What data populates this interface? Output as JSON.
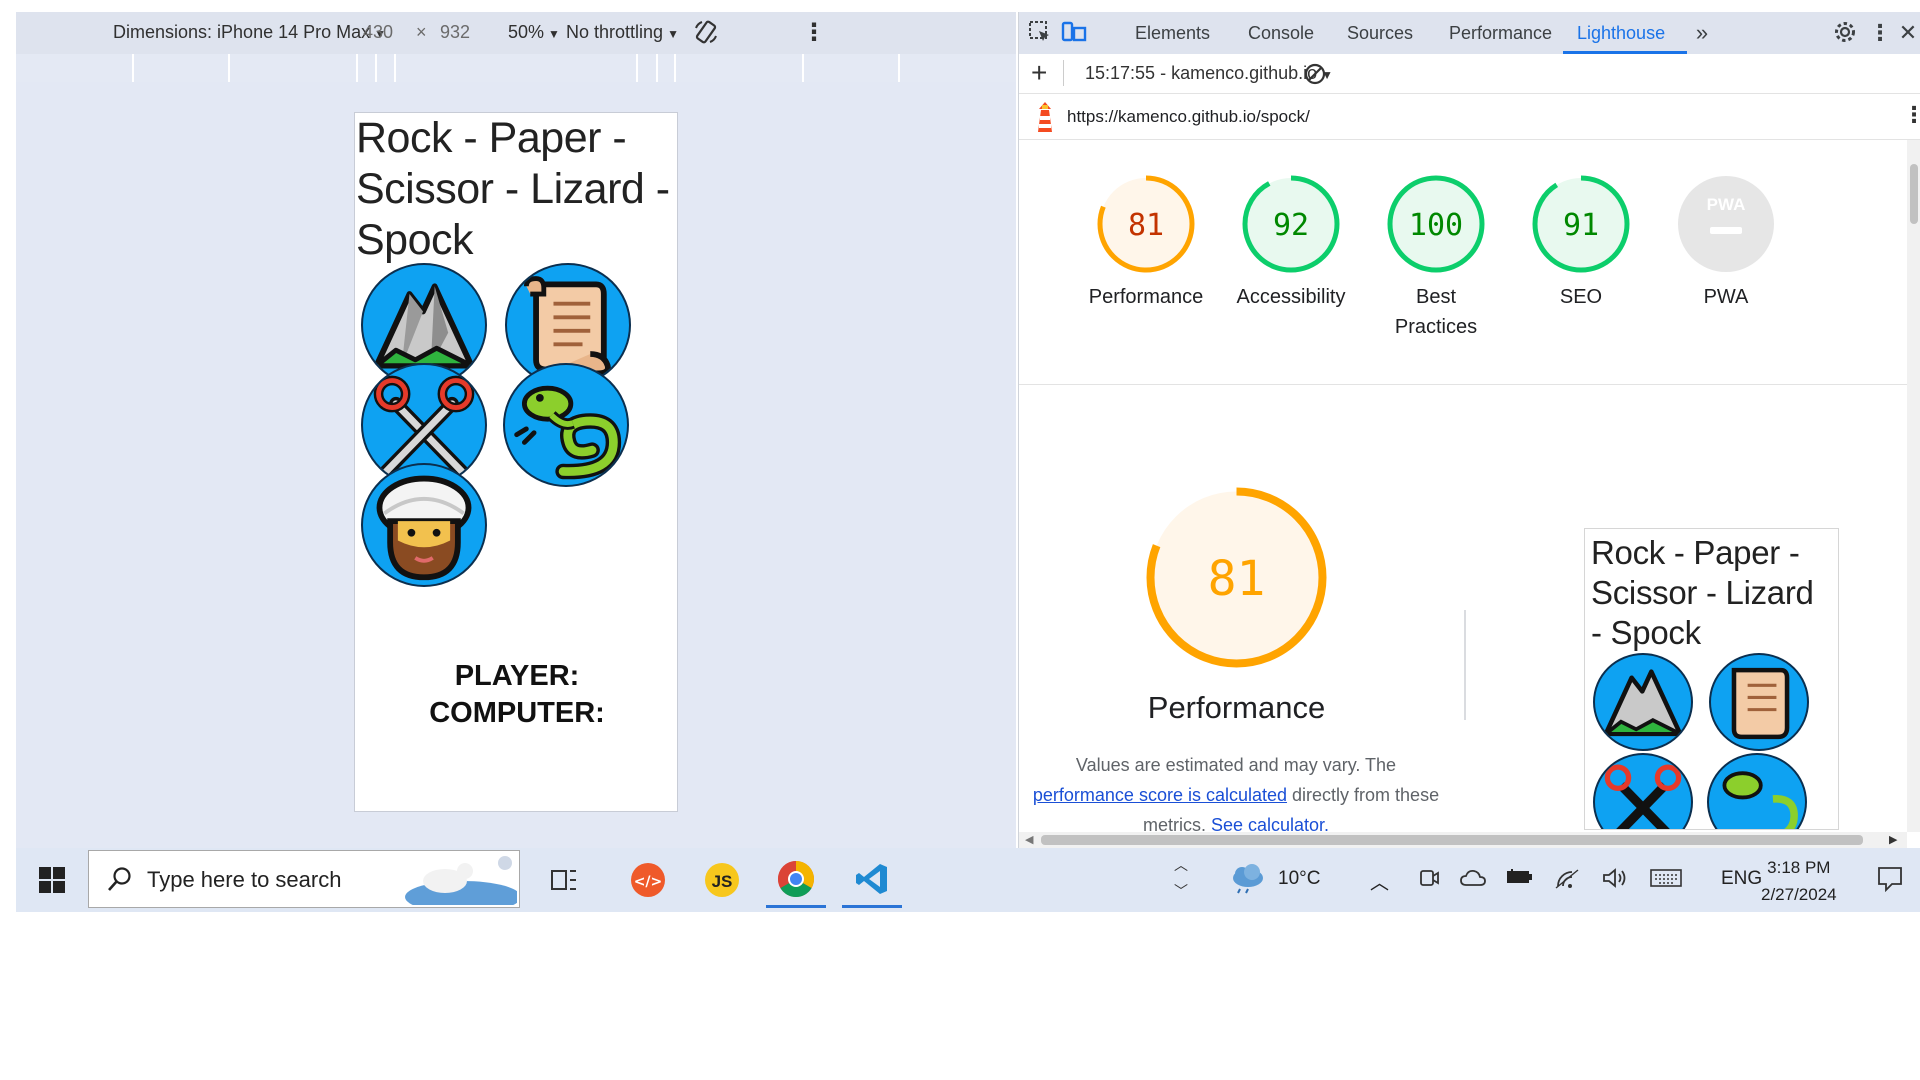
{
  "device_toolbar": {
    "dimensions_label": "Dimensions: iPhone 14 Pro Max",
    "width": "430",
    "times": "×",
    "height": "932",
    "zoom": "50%",
    "throttling": "No throttling"
  },
  "page": {
    "title": "Rock - Paper - Scissor - Lizard - Spock",
    "player_label": "PLAYER:",
    "computer_label": "COMPUTER:",
    "choices": [
      "rock",
      "paper",
      "scissors",
      "lizard",
      "spock"
    ]
  },
  "devtools": {
    "tabs": [
      "Elements",
      "Console",
      "Sources",
      "Performance",
      "Lighthouse"
    ],
    "active_tab": "Lighthouse",
    "report_selector": "15:17:55 - kamenco.github.io",
    "url": "https://kamenco.github.io/spock/",
    "scores": [
      {
        "label": "Performance",
        "value": 81,
        "color": "#fa3"
      },
      {
        "label": "Accessibility",
        "value": 92,
        "color": "#0c6"
      },
      {
        "label_line1": "Best",
        "label_line2": "Practices",
        "value": 100,
        "color": "#0c6"
      },
      {
        "label": "SEO",
        "value": 91,
        "color": "#0c6"
      },
      {
        "label": "PWA",
        "badge": "PWA"
      }
    ],
    "performance_section": {
      "score": "81",
      "title": "Performance",
      "desc_part1": "Values are estimated and may vary. The",
      "desc_link1": "performance score is calculated",
      "desc_part2": "directly from these metrics.",
      "desc_link2": "See calculator."
    },
    "thumbnail_title": "Rock - Paper - Scissor - Lizard - Spock"
  },
  "taskbar": {
    "search_placeholder": "Type here to search",
    "weather": "10°C",
    "language": "ENG",
    "time": "3:18 PM",
    "date": "2/27/2024",
    "apps": [
      "task-view",
      "devtools-app",
      "js-app",
      "chrome",
      "vscode"
    ]
  },
  "colors": {
    "gauge_orange": "#ffa400",
    "gauge_orange_text": "#c33300",
    "gauge_green": "#0cce6b",
    "gauge_green_text": "#008800",
    "accent_blue": "#1a73e8",
    "emoji_circle": "#0ea2f2"
  }
}
